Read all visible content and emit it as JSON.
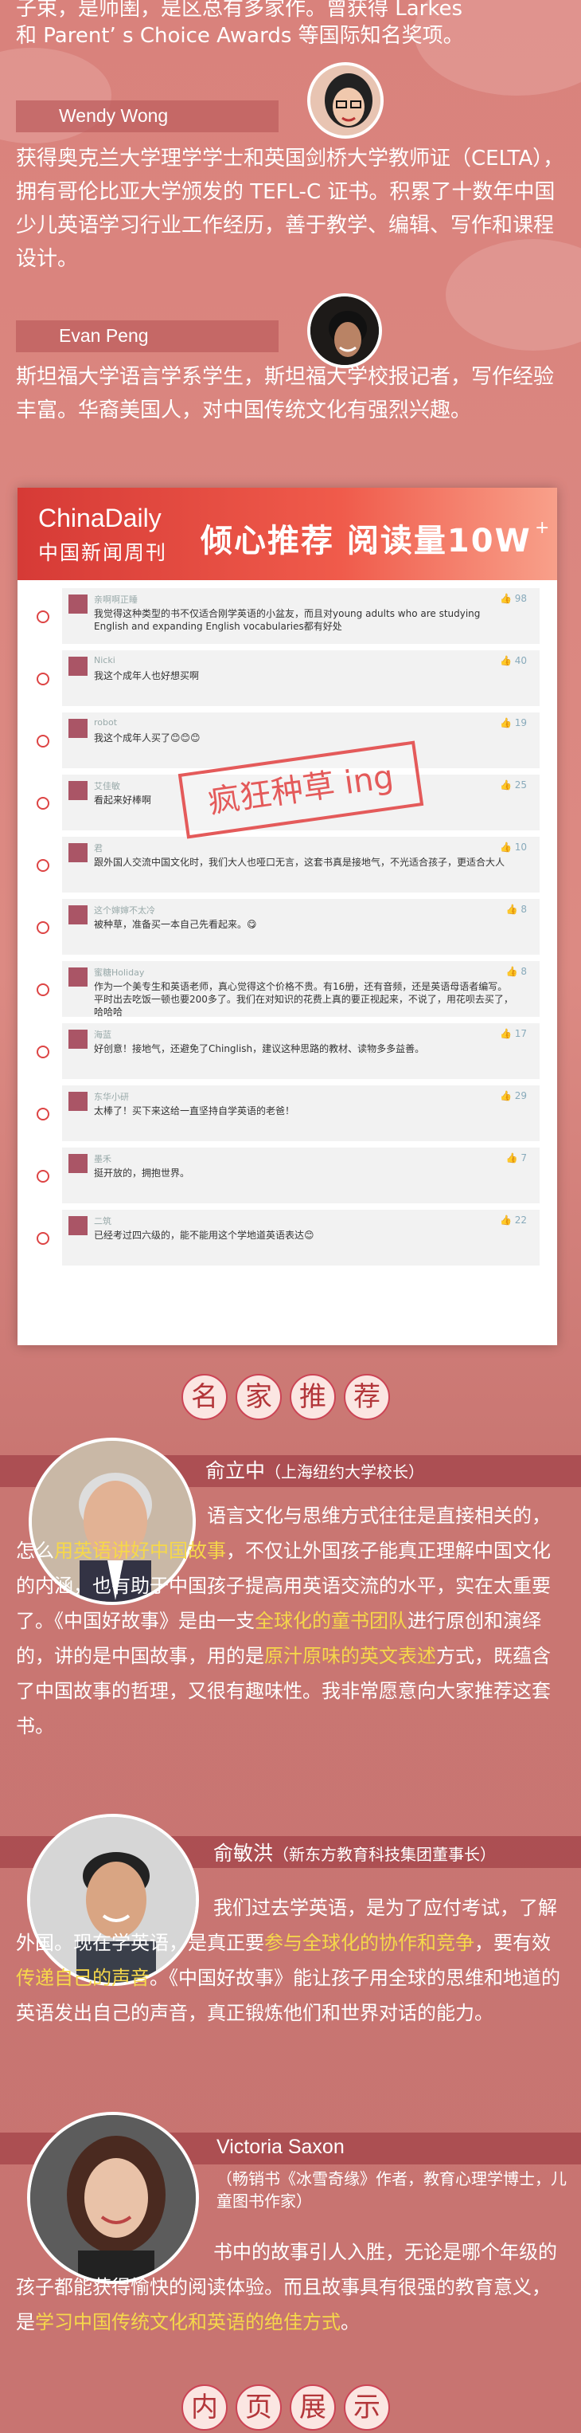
{
  "intro_tail": {
    "line1": "子束，是师圉，是区总有多家作。曾获得 Larkes",
    "line2": "和 Parent’ s Choice Awards 等国际知名奖项。"
  },
  "authors": [
    {
      "name": "Wendy Wong",
      "bio": "获得奥克兰大学理学学士和英国剑桥大学教师证（CELTA），拥有哥伦比亚大学颁发的 TEFL-C 证书。积累了十数年中国少儿英语学习行业工作经历，善于教学、编辑、写作和课程设计。"
    },
    {
      "name": "Evan Peng",
      "bio": "斯坦福大学语言学系学生，斯坦福大学校报记者，写作经验丰富。华裔美国人，对中国传统文化有强烈兴趣。"
    }
  ],
  "panel": {
    "brand": "ChinaDaily",
    "subtitle": "中国新闻周刊",
    "title": "倾心推荐 阅读量10W",
    "plus": "+",
    "stamp": "疯狂种草 ing",
    "comments": [
      {
        "user": "亲啊啊正睡",
        "text": "我觉得这种类型的书不仅适合刚学英语的小盆友，而且对young adults who are studying English and expanding English vocabularies都有好处",
        "likes": "98"
      },
      {
        "user": "Nicki",
        "text": "我这个成年人也好想买啊",
        "likes": "40"
      },
      {
        "user": "robot",
        "text": "我这个成年人买了😊😊😊",
        "likes": "19"
      },
      {
        "user": "艾佳敏",
        "text": "看起来好棒啊",
        "likes": "25"
      },
      {
        "user": "君",
        "text": "跟外国人交流中国文化时，我们大人也哑口无言，这套书真是接地气，不光适合孩子，更适合大人",
        "likes": "10"
      },
      {
        "user": "这个婶婶不太冷",
        "text": "被种草，准备买一本自己先看起来。😋",
        "likes": "8"
      },
      {
        "user": "蜜糖Holiday",
        "text": "作为一个美专生和英语老师，真心觉得这个价格不贵。有16册，还有音频，还是英语母语者编写。平时出去吃饭一顿也要200多了。我们在对知识的花费上真的要正视起来，不说了，用花呗去买了，哈哈哈",
        "likes": "8"
      },
      {
        "user": "海蓝",
        "text": "好创意！接地气，还避免了Chinglish，建议这种思路的教材、读物多多益善。",
        "likes": "17"
      },
      {
        "user": "东华小研",
        "text": "太棒了！买下来这给一直坚持自学英语的老爸！",
        "likes": "29"
      },
      {
        "user": "墨禾",
        "text": "挺开放的，拥抱世界。",
        "likes": "7"
      },
      {
        "user": "二筑",
        "text": "已经考过四六级的，能不能用这个学地道英语表达😊",
        "likes": "22"
      }
    ]
  },
  "section_experts": [
    "名",
    "家",
    "推",
    "荐"
  ],
  "section_pages": [
    "内",
    "页",
    "展",
    "示"
  ],
  "experts": [
    {
      "name": "俞立中",
      "title": "（上海纽约大学校长）",
      "p1": "语言文化与思维方式往往是直接相关的，怎么",
      "h1": "用英语讲好中国故事",
      "p2": "，不仅让外国孩子能真正理解中国文化的内涵，也有助于中国孩子提高用英语交流的水平，实在太重要了。《中国好故事》是由一支",
      "h2": "全球化的童书团队",
      "p3": "进行原创和演绎的，讲的是中国故事，用的是",
      "h3": "原汁原味的英文表述",
      "p4": "方式，既蕴含了中国故事的哲理，又很有趣味性。我非常愿意向大家推荐这套书。"
    },
    {
      "name": "俞敏洪",
      "title": "（新东方教育科技集团董事长）",
      "p1": "我们过去学英语，是为了应付考试，了解外国。现在学英语，是真正要",
      "h1": "参与全球化的协作和竞争",
      "p2": "，要有效",
      "h2": "传递自己的声音",
      "p3": "。《中国好故事》能让孩子用全球的思维和地道的英语发出自己的声音，真正锻炼他们和世界对话的能力。"
    },
    {
      "name": "Victoria Saxon",
      "title": "（畅销书《冰雪奇缘》作者，教育心理学博士，儿童图书作家）",
      "p1": "书中的故事引人入胜，无论是哪个年级的孩子都能获得愉快的阅读体验。而且故事具有很强的教育意义，是",
      "h1": "学习中国传统文化和英语的绝佳方式",
      "p2": "。"
    }
  ]
}
